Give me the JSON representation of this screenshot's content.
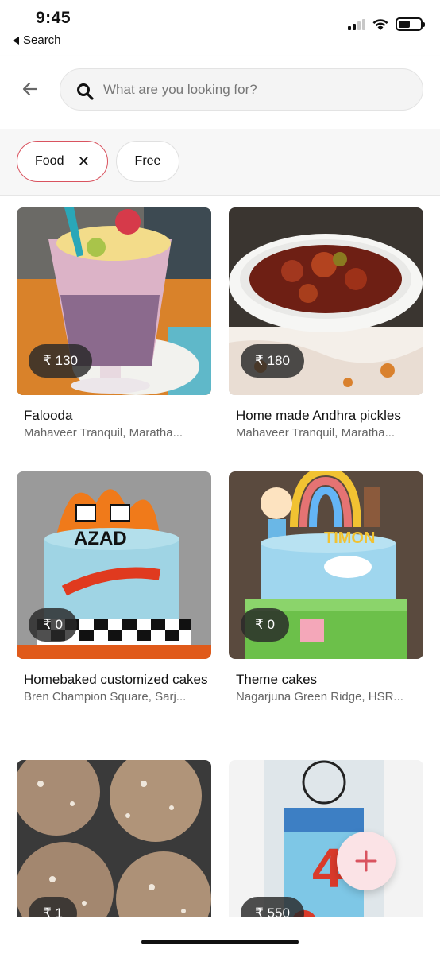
{
  "status_bar": {
    "time": "9:45",
    "back_label": "Search"
  },
  "search": {
    "placeholder": "What are you looking for?"
  },
  "filters": [
    {
      "label": "Food",
      "active": true,
      "removable": true
    },
    {
      "label": "Free",
      "active": false
    }
  ],
  "listings": [
    {
      "title": "Falooda",
      "location": "Mahaveer Tranquil, Maratha...",
      "price": "₹ 130",
      "image": "falooda-glass"
    },
    {
      "title": "Home made Andhra pickles",
      "location": "Mahaveer Tranquil, Maratha...",
      "price": "₹ 180",
      "image": "pickle-bowl"
    },
    {
      "title": "Homebaked customized cakes",
      "location": "Bren Champion Square, Sarj...",
      "price": "₹ 0",
      "image": "hot-wheels-cake"
    },
    {
      "title": "Theme cakes",
      "location": "Nagarjuna Green Ridge, HSR...",
      "price": "₹ 0",
      "image": "cocomelon-cake"
    },
    {
      "title": "",
      "location": "",
      "price": "₹ 1",
      "image": "laddoos"
    },
    {
      "title": "",
      "location": "",
      "price": "₹ 550",
      "image": "spiderman-cake"
    }
  ],
  "colors": {
    "accent": "#d9535f",
    "chip_border": "#e0e0e0",
    "fab_bg": "#fbe3e6"
  },
  "icons": {
    "back": "arrow-left-icon",
    "search": "search-icon",
    "add": "plus-icon"
  }
}
